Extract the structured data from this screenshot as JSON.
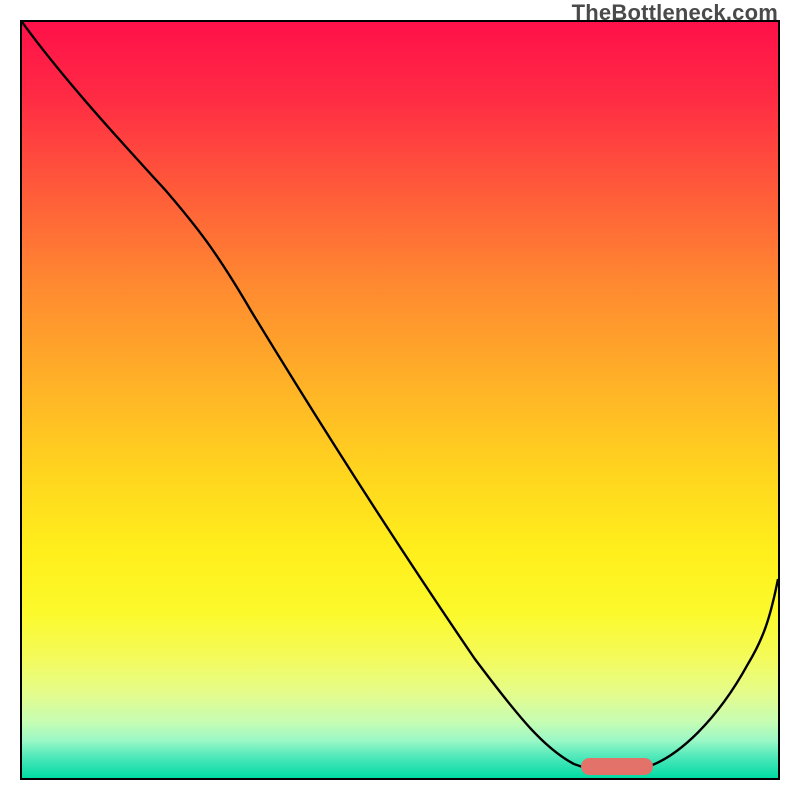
{
  "watermark": "TheBottleneck.com",
  "chart_data": {
    "type": "line",
    "title": "",
    "xlabel": "",
    "ylabel": "",
    "xlim": [
      0,
      100
    ],
    "ylim": [
      0,
      100
    ],
    "grid": false,
    "legend": false,
    "background_gradient": {
      "direction": "vertical",
      "stops": [
        {
          "pos": 0,
          "color": "#ff1049"
        },
        {
          "pos": 0.35,
          "color": "#ff8a30"
        },
        {
          "pos": 0.7,
          "color": "#ffef1c"
        },
        {
          "pos": 1.0,
          "color": "#00dba4"
        }
      ]
    },
    "series": [
      {
        "name": "bottleneck-curve",
        "x": [
          0,
          8,
          18,
          25,
          35,
          45,
          55,
          65,
          72,
          75,
          80,
          85,
          92,
          100
        ],
        "y": [
          100,
          92,
          82,
          75,
          62,
          49,
          36,
          21,
          9,
          3,
          1,
          2,
          14,
          30
        ]
      }
    ],
    "marker": {
      "name": "optimal-range",
      "x_start": 74,
      "x_end": 83,
      "y": 2,
      "color": "#e2726a"
    }
  }
}
